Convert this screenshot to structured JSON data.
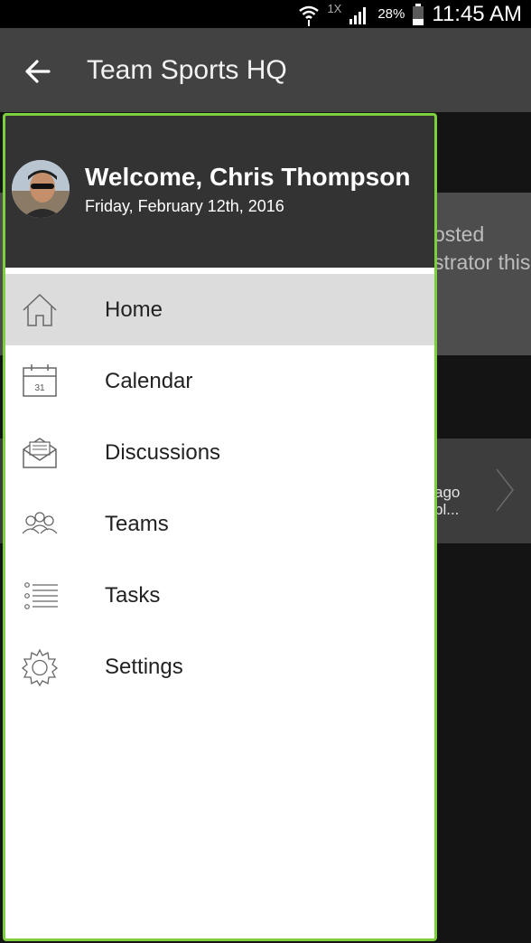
{
  "status_bar": {
    "network_label": "1X",
    "battery": "28%",
    "time": "11:45 AM"
  },
  "app_bar": {
    "title": "Team Sports HQ",
    "back_icon": "arrow-left-icon"
  },
  "background": {
    "card1_text": "osted strator this",
    "card2_line1": "ago",
    "card2_line2": "pl..."
  },
  "drawer": {
    "welcome": "Welcome, Chris  Thompson",
    "date": "Friday, February 12th, 2016",
    "accent_color": "#7dcf3c",
    "items": [
      {
        "label": "Home",
        "icon": "home-icon",
        "active": true
      },
      {
        "label": "Calendar",
        "icon": "calendar-icon",
        "icon_text": "31"
      },
      {
        "label": "Discussions",
        "icon": "envelope-icon"
      },
      {
        "label": "Teams",
        "icon": "people-icon"
      },
      {
        "label": "Tasks",
        "icon": "list-icon"
      },
      {
        "label": "Settings",
        "icon": "gear-icon"
      }
    ]
  }
}
